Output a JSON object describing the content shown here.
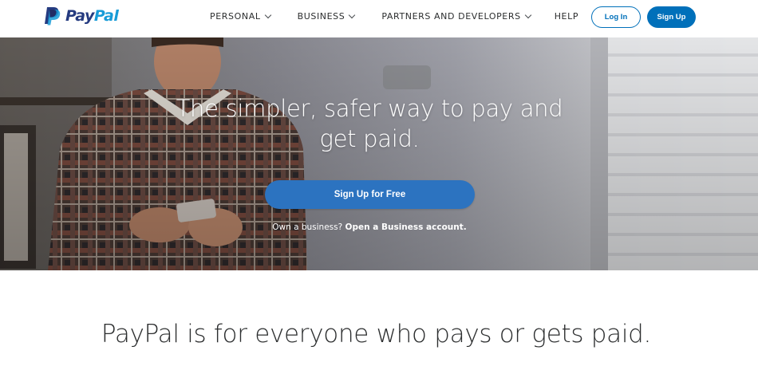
{
  "header": {
    "logo_text_pay": "Pay",
    "logo_text_pal": "Pal",
    "nav": [
      {
        "label": "PERSONAL",
        "has_dropdown": true
      },
      {
        "label": "BUSINESS",
        "has_dropdown": true
      },
      {
        "label": "PARTNERS AND DEVELOPERS",
        "has_dropdown": true
      },
      {
        "label": "HELP",
        "has_dropdown": false
      }
    ],
    "login_label": "Log In",
    "signup_label": "Sign Up"
  },
  "hero": {
    "title": "The simpler, safer way to pay and get paid.",
    "cta_label": "Sign Up for Free",
    "sub_prefix": "Own a business?",
    "sub_link": "Open a Business account."
  },
  "tagline": "PayPal is for everyone who pays or gets paid.",
  "colors": {
    "brand_dark": "#253b80",
    "brand_light": "#179bd7",
    "accent": "#0070ba",
    "cta": "#2c73c0"
  },
  "icons": [
    "paypal-logo-icon",
    "chevron-down-icon"
  ]
}
